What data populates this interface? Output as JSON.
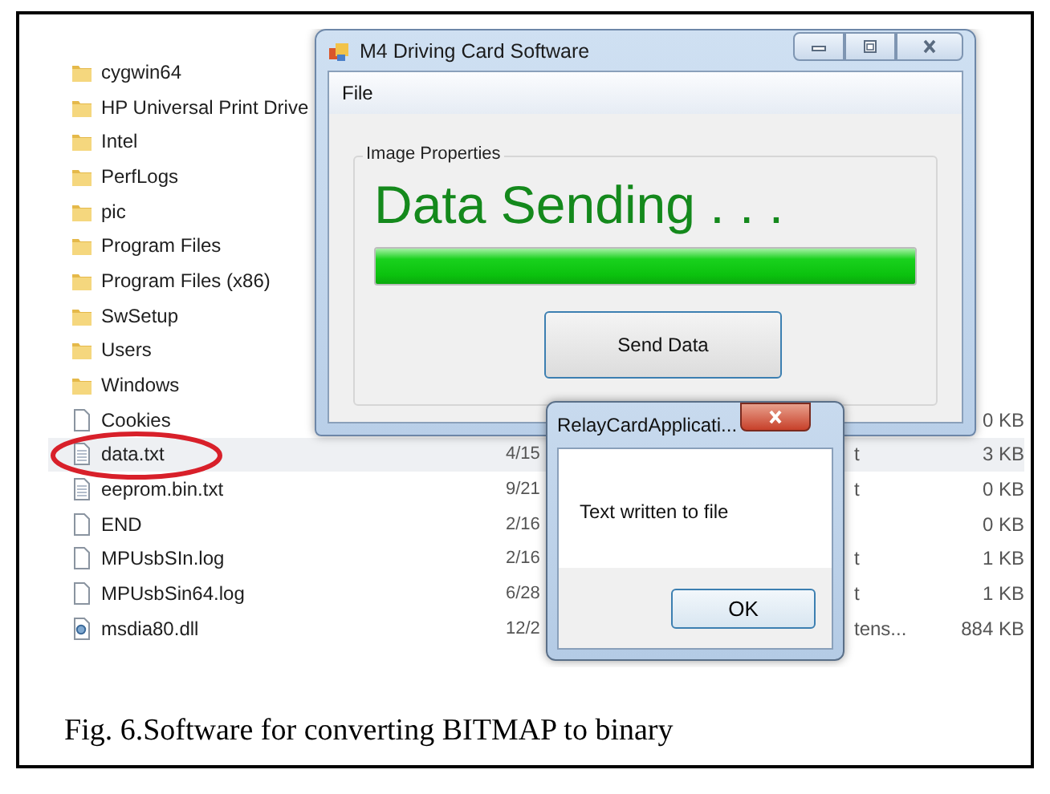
{
  "explorer": {
    "items": [
      {
        "name": "cygwin64",
        "kind": "folder",
        "selected": false,
        "circled": false
      },
      {
        "name": "HP Universal Print Drive",
        "kind": "folder",
        "selected": false,
        "circled": false
      },
      {
        "name": "Intel",
        "kind": "folder",
        "selected": false,
        "circled": false
      },
      {
        "name": "PerfLogs",
        "kind": "folder",
        "selected": false,
        "circled": false
      },
      {
        "name": "pic",
        "kind": "folder",
        "selected": false,
        "circled": false
      },
      {
        "name": "Program Files",
        "kind": "folder",
        "selected": false,
        "circled": false
      },
      {
        "name": "Program Files (x86)",
        "kind": "folder",
        "selected": false,
        "circled": false
      },
      {
        "name": "SwSetup",
        "kind": "folder",
        "selected": false,
        "circled": false
      },
      {
        "name": "Users",
        "kind": "folder",
        "selected": false,
        "circled": false
      },
      {
        "name": "Windows",
        "kind": "folder",
        "selected": false,
        "circled": false
      },
      {
        "name": "Cookies",
        "kind": "blank",
        "size": "0 KB",
        "selected": false,
        "circled": false
      },
      {
        "name": "data.txt",
        "kind": "text",
        "date": "4/15",
        "type": "t",
        "size": "3 KB",
        "selected": true,
        "circled": true
      },
      {
        "name": "eeprom.bin.txt",
        "kind": "text",
        "date": "9/21",
        "type": "t",
        "size": "0 KB",
        "selected": false,
        "circled": false
      },
      {
        "name": "END",
        "kind": "blank",
        "date": "2/16",
        "size": "0 KB",
        "selected": false,
        "circled": false
      },
      {
        "name": "MPUsbSIn.log",
        "kind": "blank",
        "date": "2/16",
        "type": "t",
        "size": "1 KB",
        "selected": false,
        "circled": false
      },
      {
        "name": "MPUsbSin64.log",
        "kind": "blank",
        "date": "6/28",
        "type": "t",
        "size": "1 KB",
        "selected": false,
        "circled": false
      },
      {
        "name": "msdia80.dll",
        "kind": "dll",
        "date": "12/2",
        "type": "tens...",
        "size": "884 KB",
        "selected": false,
        "circled": false
      }
    ]
  },
  "main_window": {
    "title": "M4 Driving Card Software",
    "menu": [
      "File"
    ],
    "group_label": "Image Properties",
    "status": "Data Sending . . .",
    "progress": {
      "level": 1
    },
    "button": "Send Data"
  },
  "dialog": {
    "title": "RelayCardApplicati...",
    "message": "Text written to file",
    "button": "OK"
  },
  "caption": "Fig. 6.Software for converting BITMAP to binary"
}
